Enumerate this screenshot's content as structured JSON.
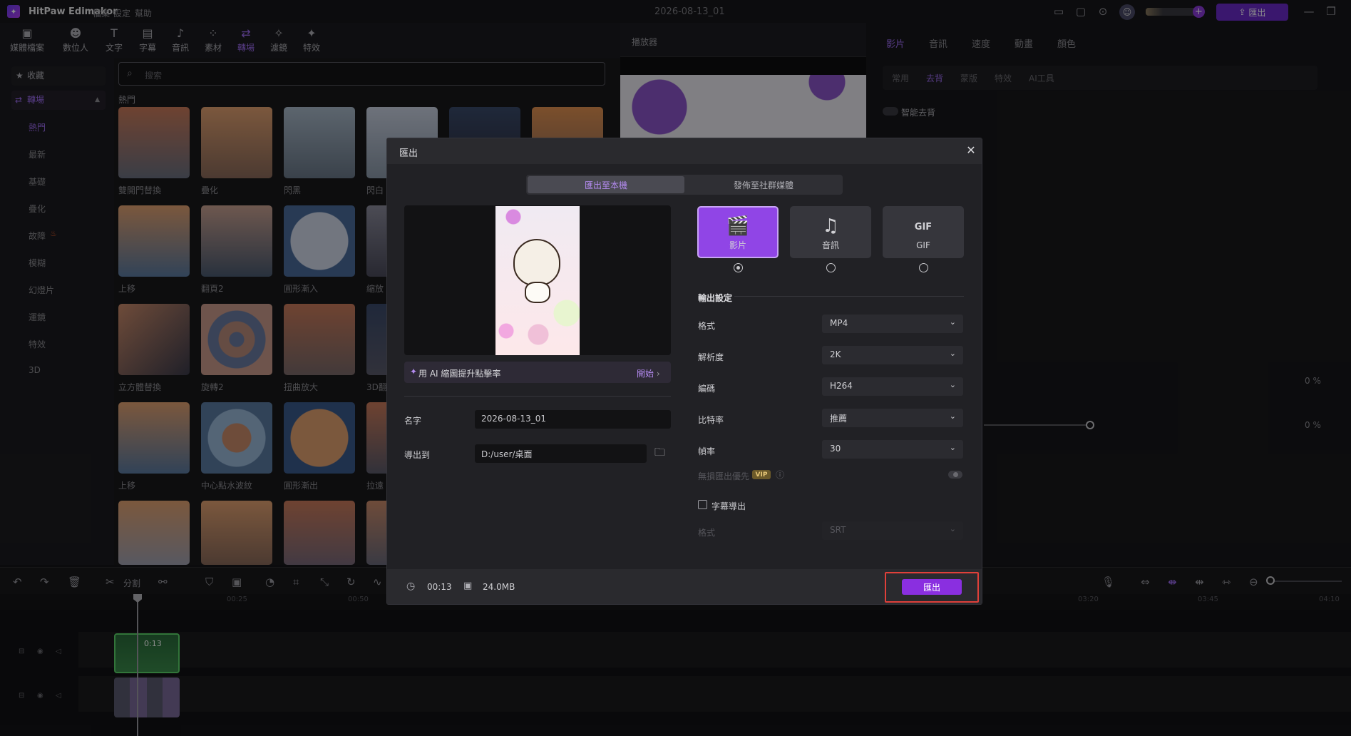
{
  "titlebar": {
    "app_name": "HitPaw Edimakor",
    "menus": [
      "檔案",
      "設定",
      "幫助"
    ],
    "file_name": "2026-08-13_01",
    "export_label": "匯出"
  },
  "toolbar": {
    "items": [
      {
        "label": "媒體檔案",
        "icon": "media-icon"
      },
      {
        "label": "數位人",
        "icon": "avatar-icon"
      },
      {
        "label": "文字",
        "icon": "text-icon"
      },
      {
        "label": "字幕",
        "icon": "subtitle-icon"
      },
      {
        "label": "音訊",
        "icon": "audio-icon"
      },
      {
        "label": "素材",
        "icon": "elements-icon"
      },
      {
        "label": "轉場",
        "icon": "transition-icon"
      },
      {
        "label": "濾鏡",
        "icon": "filter-icon"
      },
      {
        "label": "特效",
        "icon": "effects-icon"
      }
    ]
  },
  "left_nav": {
    "favorites": "收藏",
    "transitions": "轉場",
    "items": [
      "熱門",
      "最新",
      "基礎",
      "疊化",
      "故障",
      "模糊",
      "幻燈片",
      "運鏡",
      "特效",
      "3D"
    ]
  },
  "search": {
    "placeholder": "搜索"
  },
  "content": {
    "section": "熱門",
    "thumbs": [
      [
        "雙開門替換",
        "疊化",
        "閃黑",
        "閃白"
      ],
      [
        "上移",
        "翻頁2",
        "圓形漸入",
        "縮放"
      ],
      [
        "立方體替換",
        "旋轉2",
        "扭曲放大",
        "3D翻"
      ],
      [
        "上移",
        "中心點水波紋",
        "圓形漸出",
        "拉遠"
      ]
    ]
  },
  "player": {
    "title": "播放器"
  },
  "right_panel": {
    "tabs": [
      "影片",
      "音訊",
      "速度",
      "動畫",
      "顏色"
    ],
    "subtabs": [
      "常用",
      "去背",
      "蒙版",
      "特效",
      "AI工具"
    ],
    "smart_bg": "智能去背",
    "pct1": "0 %",
    "pct2": "0 %"
  },
  "timeline": {
    "split": "分割",
    "ruler": [
      "00:25",
      "00:50",
      "03:20",
      "03:45",
      "04:10"
    ],
    "clip_duration": "0:13"
  },
  "dialog": {
    "title": "匯出",
    "tab_local": "匯出至本機",
    "tab_social": "發佈至社群媒體",
    "ai_text": "用 AI 縮圖提升點擊率",
    "ai_start": "開始",
    "name_label": "名字",
    "name_value": "2026-08-13_01",
    "path_label": "導出到",
    "path_value": "D:/user/桌面",
    "formats": [
      "影片",
      "音訊",
      "GIF"
    ],
    "output_title": "輸出設定",
    "settings": [
      {
        "label": "格式",
        "value": "MP4"
      },
      {
        "label": "解析度",
        "value": "2K"
      },
      {
        "label": "編碼",
        "value": "H264"
      },
      {
        "label": "比特率",
        "value": "推薦"
      },
      {
        "label": "幀率",
        "value": "30"
      }
    ],
    "lossless_label": "無損匯出優先",
    "vip": "VIP",
    "subtitle_export": "字幕導出",
    "sub_format_label": "格式",
    "sub_format_value": "SRT",
    "duration": "00:13",
    "size": "24.0MB",
    "export_button": "匯出"
  },
  "colors": {
    "accent": "#9d6cf0",
    "export_btn": "#8a2fe0",
    "highlight_outline": "#e0403a"
  }
}
